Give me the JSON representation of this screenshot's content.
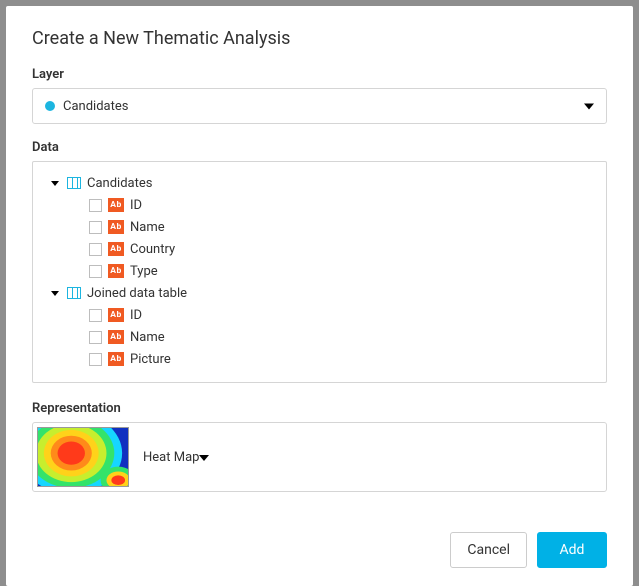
{
  "dialog": {
    "title": "Create a New Thematic Analysis",
    "layer_label": "Layer",
    "layer_value": "Candidates",
    "data_label": "Data",
    "representation_label": "Representation",
    "representation_value": "Heat Map",
    "cancel": "Cancel",
    "add": "Add"
  },
  "tree": {
    "nodes": [
      {
        "label": "Candidates",
        "fields": [
          {
            "label": "ID"
          },
          {
            "label": "Name"
          },
          {
            "label": "Country"
          },
          {
            "label": "Type"
          }
        ]
      },
      {
        "label": "Joined data table",
        "fields": [
          {
            "label": "ID"
          },
          {
            "label": "Name"
          },
          {
            "label": "Picture"
          }
        ]
      }
    ]
  },
  "icons": {
    "abc": "Ab"
  }
}
